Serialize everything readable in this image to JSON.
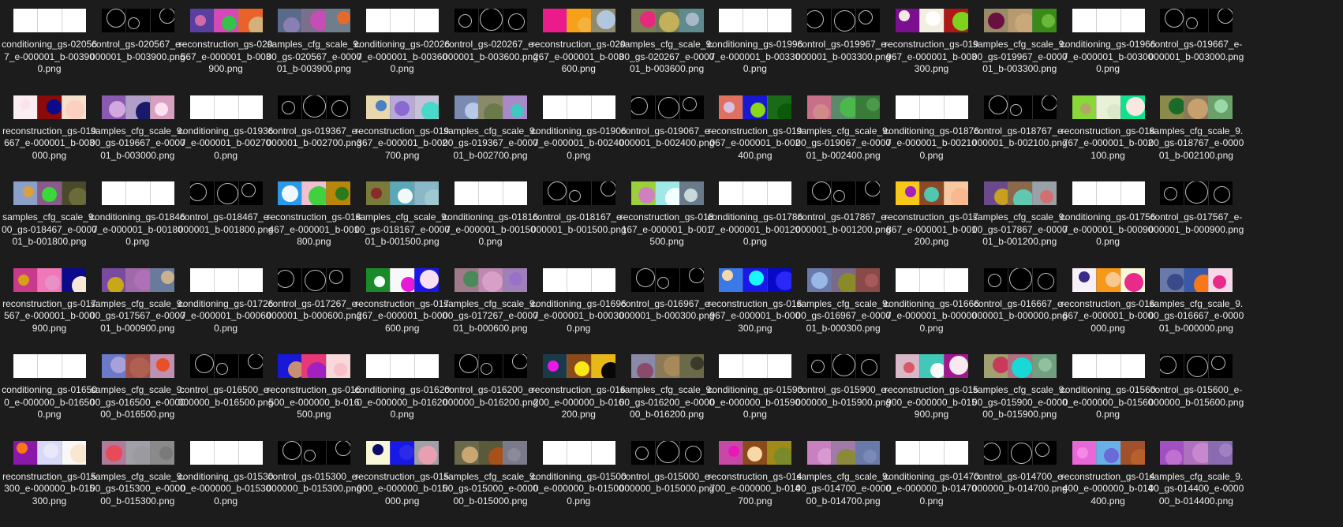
{
  "files": [
    {
      "name": "conditioning_gs-020567_e-000001_b-003900.png",
      "thumb": "cond"
    },
    {
      "name": "control_gs-020567_e-000001_b-003900.png",
      "thumb": "ctrl"
    },
    {
      "name": "reconstruction_gs-020567_e-000001_b-003900.png",
      "thumb": "color",
      "panels": [
        {
          "bg": "#5a3fa0",
          "dot": "#d36aa8"
        },
        {
          "bg": "#d946b9",
          "dot": "#33c24a"
        },
        {
          "bg": "#e8622a",
          "dot": "#d6b07a"
        }
      ]
    },
    {
      "name": "samples_cfg_scale_9.00_gs-020567_e-000001_b-003900.png",
      "thumb": "color",
      "panels": [
        {
          "bg": "#5a6a8a",
          "dot": "#8a7fb3"
        },
        {
          "bg": "#7c6f8c",
          "dot": "#c44db6"
        },
        {
          "bg": "#6f7d8c",
          "dot": "#e46b2c"
        }
      ]
    },
    {
      "name": "conditioning_gs-020267_e-000001_b-003600.png",
      "thumb": "cond"
    },
    {
      "name": "control_gs-020267_e-000001_b-003600.png",
      "thumb": "ctrl"
    },
    {
      "name": "reconstruction_gs-020267_e-000001_b-003600.png",
      "thumb": "color",
      "panels": [
        {
          "bg": "#ec1b8c",
          "dot": "#ec1b8c"
        },
        {
          "bg": "#f7a11a",
          "dot": "#f5b03d"
        },
        {
          "bg": "#8e8c6a",
          "dot": "#b2c6e0"
        }
      ]
    },
    {
      "name": "samples_cfg_scale_9.00_gs-020267_e-000001_b-003600.png",
      "thumb": "color",
      "panels": [
        {
          "bg": "#7d7d56",
          "dot": "#e5297d"
        },
        {
          "bg": "#6a7a5a",
          "dot": "#c2b15a"
        },
        {
          "bg": "#5f8a8f",
          "dot": "#a8b8c8"
        }
      ]
    },
    {
      "name": "conditioning_gs-019967_e-000001_b-003300.png",
      "thumb": "cond"
    },
    {
      "name": "control_gs-019967_e-000001_b-003300.png",
      "thumb": "ctrl"
    },
    {
      "name": "reconstruction_gs-019967_e-000001_b-003300.png",
      "thumb": "color",
      "panels": [
        {
          "bg": "#7b0f8f",
          "dot": "#f4e9e0"
        },
        {
          "bg": "#f2eee0",
          "dot": "#fefefe"
        },
        {
          "bg": "#b01818",
          "dot": "#7ed11f"
        }
      ]
    },
    {
      "name": "samples_cfg_scale_9.00_gs-019967_e-000001_b-003300.png",
      "thumb": "color",
      "panels": [
        {
          "bg": "#9a8a68",
          "dot": "#6a0f3f"
        },
        {
          "bg": "#b89a70",
          "dot": "#c9a87a"
        },
        {
          "bg": "#3a8a1a",
          "dot": "#6ab83a"
        }
      ]
    },
    {
      "name": "conditioning_gs-019667_e-000001_b-003000.png",
      "thumb": "cond"
    },
    {
      "name": "control_gs-019667_e-000001_b-003000.png",
      "thumb": "ctrl"
    },
    {
      "name": "reconstruction_gs-019667_e-000001_b-003000.png",
      "thumb": "color",
      "panels": [
        {
          "bg": "#fbeef2",
          "dot": "#fde3ea"
        },
        {
          "bg": "#8b0a0a",
          "dot": "#0a0a8a"
        },
        {
          "bg": "#f4e0cc",
          "dot": "#fbd0c0"
        }
      ]
    },
    {
      "name": "samples_cfg_scale_9.00_gs-019667_e-000001_b-003000.png",
      "thumb": "color",
      "panels": [
        {
          "bg": "#8a5ab0",
          "dot": "#d3a8e0"
        },
        {
          "bg": "#b0a0c8",
          "dot": "#1a1a6a"
        },
        {
          "bg": "#d8a0c0",
          "dot": "#fbe0ee"
        }
      ]
    },
    {
      "name": "conditioning_gs-019367_e-000001_b-002700.png",
      "thumb": "cond"
    },
    {
      "name": "control_gs-019367_e-000001_b-002700.png",
      "thumb": "ctrl"
    },
    {
      "name": "reconstruction_gs-019367_e-000001_b-002700.png",
      "thumb": "color",
      "panels": [
        {
          "bg": "#e8d8b0",
          "dot": "#4a80c0"
        },
        {
          "bg": "#b9a9d9",
          "dot": "#8a6ad0"
        },
        {
          "bg": "#c8c0d8",
          "dot": "#4ad8c8"
        }
      ]
    },
    {
      "name": "samples_cfg_scale_9.00_gs-019367_e-000001_b-002700.png",
      "thumb": "color",
      "panels": [
        {
          "bg": "#7a8ab0",
          "dot": "#b8c8e8"
        },
        {
          "bg": "#8a8a6a",
          "dot": "#6a7a4a"
        },
        {
          "bg": "#a88ac8",
          "dot": "#40c8c0"
        }
      ]
    },
    {
      "name": "conditioning_gs-019067_e-000001_b-002400.png",
      "thumb": "cond"
    },
    {
      "name": "control_gs-019067_e-000001_b-002400.png",
      "thumb": "ctrl"
    },
    {
      "name": "reconstruction_gs-019067_e-000001_b-002400.png",
      "thumb": "color",
      "panels": [
        {
          "bg": "#e07060",
          "dot": "#d8c0e0"
        },
        {
          "bg": "#1818d0",
          "dot": "#8ad818"
        },
        {
          "bg": "#1a6a1a",
          "dot": "#0a5a0a"
        }
      ]
    },
    {
      "name": "samples_cfg_scale_9.00_gs-019067_e-000001_b-002400.png",
      "thumb": "color",
      "panels": [
        {
          "bg": "#c8708a",
          "dot": "#d08a8a"
        },
        {
          "bg": "#5a8a6a",
          "dot": "#4ab84a"
        },
        {
          "bg": "#3a7a3a",
          "dot": "#4a9a4a"
        }
      ]
    },
    {
      "name": "conditioning_gs-018767_e-000001_b-002100.png",
      "thumb": "cond"
    },
    {
      "name": "control_gs-018767_e-000001_b-002100.png",
      "thumb": "ctrl"
    },
    {
      "name": "reconstruction_gs-018767_e-000001_b-002100.png",
      "thumb": "color",
      "panels": [
        {
          "bg": "#8ad838",
          "dot": "#b0a868"
        },
        {
          "bg": "#e8f0d8",
          "dot": "#d8e8c8"
        },
        {
          "bg": "#10e090",
          "dot": "#f8e8e0"
        }
      ]
    },
    {
      "name": "samples_cfg_scale_9.00_gs-018767_e-000001_b-002100.png",
      "thumb": "color",
      "panels": [
        {
          "bg": "#8a8a4a",
          "dot": "#1a6a2a"
        },
        {
          "bg": "#8a7a5a",
          "dot": "#c8a070"
        },
        {
          "bg": "#6aa06a",
          "dot": "#9ad8a8"
        }
      ]
    },
    {
      "name": "samples_cfg_scale_9.00_gs-018467_e-000001_b-001800.png",
      "thumb": "color",
      "panels": [
        {
          "bg": "#8aa0c8",
          "dot": "#d8a040"
        },
        {
          "bg": "#8a5a8a",
          "dot": "#3ad83a"
        },
        {
          "bg": "#4a4a2a",
          "dot": "#6a6a3a"
        }
      ]
    },
    {
      "name": "conditioning_gs-018467_e-000001_b-001800.png",
      "thumb": "cond"
    },
    {
      "name": "control_gs-018467_e-000001_b-001800.png",
      "thumb": "ctrl"
    },
    {
      "name": "reconstruction_gs-018467_e-000001_b-001800.png",
      "thumb": "color",
      "panels": [
        {
          "bg": "#2a9ae8",
          "dot": "#f0f8ff"
        },
        {
          "bg": "#f0c0d0",
          "dot": "#40d040"
        },
        {
          "bg": "#b8860b",
          "dot": "#2a7a1a"
        }
      ]
    },
    {
      "name": "samples_cfg_scale_9.00_gs-018167_e-000001_b-001500.png",
      "thumb": "color",
      "panels": [
        {
          "bg": "#7a7a3a",
          "dot": "#8a2a2a"
        },
        {
          "bg": "#5aa8b8",
          "dot": "#f0f8f8"
        },
        {
          "bg": "#8ab8c8",
          "dot": "#a0c8d0"
        }
      ]
    },
    {
      "name": "conditioning_gs-018167_e-000001_b-001500.png",
      "thumb": "cond"
    },
    {
      "name": "control_gs-018167_e-000001_b-001500.png",
      "thumb": "ctrl"
    },
    {
      "name": "reconstruction_gs-018167_e-000001_b-001500.png",
      "thumb": "color",
      "panels": [
        {
          "bg": "#9ad038",
          "dot": "#d080c0"
        },
        {
          "bg": "#a0e8e8",
          "dot": "#f0ffff"
        },
        {
          "bg": "#6a7a8a",
          "dot": "#c8d8d8"
        }
      ]
    },
    {
      "name": "conditioning_gs-017867_e-000001_b-001200.png",
      "thumb": "cond"
    },
    {
      "name": "control_gs-017867_e-000001_b-001200.png",
      "thumb": "ctrl"
    },
    {
      "name": "reconstruction_gs-017867_e-000001_b-001200.png",
      "thumb": "color",
      "panels": [
        {
          "bg": "#f8c818",
          "dot": "#a020c0"
        },
        {
          "bg": "#8a4a2a",
          "dot": "#50c8b0"
        },
        {
          "bg": "#f8c8a0",
          "dot": "#f8b890"
        }
      ]
    },
    {
      "name": "samples_cfg_scale_9.00_gs-017867_e-000001_b-001200.png",
      "thumb": "color",
      "panels": [
        {
          "bg": "#6a4a8a",
          "dot": "#c8a020"
        },
        {
          "bg": "#8a6a4a",
          "dot": "#60c8b0"
        },
        {
          "bg": "#9aa0a8",
          "dot": "#d07070"
        }
      ]
    },
    {
      "name": "conditioning_gs-017567_e-000001_b-000900.png",
      "thumb": "cond"
    },
    {
      "name": "control_gs-017567_e-000001_b-000900.png",
      "thumb": "ctrl"
    },
    {
      "name": "reconstruction_gs-017567_e-000001_b-000900.png",
      "thumb": "color",
      "panels": [
        {
          "bg": "#c83a8a",
          "dot": "#d8a018"
        },
        {
          "bg": "#f078b8",
          "dot": "#e890c8"
        },
        {
          "bg": "#0a0a8a",
          "dot": "#f8e8d8"
        }
      ]
    },
    {
      "name": "samples_cfg_scale_9.00_gs-017567_e-000001_b-000900.png",
      "thumb": "color",
      "panels": [
        {
          "bg": "#7a4aa0",
          "dot": "#c8a818"
        },
        {
          "bg": "#a06aa8",
          "dot": "#b070b8"
        },
        {
          "bg": "#6a7a9a",
          "dot": "#c8b090"
        }
      ]
    },
    {
      "name": "conditioning_gs-017267_e-000001_b-000600.png",
      "thumb": "cond"
    },
    {
      "name": "control_gs-017267_e-000001_b-000600.png",
      "thumb": "ctrl"
    },
    {
      "name": "reconstruction_gs-017267_e-000001_b-000600.png",
      "thumb": "color",
      "panels": [
        {
          "bg": "#1a8a2a",
          "dot": "#f0fff8"
        },
        {
          "bg": "#f8f8f8",
          "dot": "#e818d8"
        },
        {
          "bg": "#1818e8",
          "dot": "#f8e0f0"
        }
      ]
    },
    {
      "name": "samples_cfg_scale_9.00_gs-017267_e-000001_b-000600.png",
      "thumb": "color",
      "panels": [
        {
          "bg": "#a07a8a",
          "dot": "#4a8a5a"
        },
        {
          "bg": "#c088b0",
          "dot": "#d8a0c8"
        },
        {
          "bg": "#a080b8",
          "dot": "#9a70c8"
        }
      ]
    },
    {
      "name": "conditioning_gs-016967_e-000001_b-000300.png",
      "thumb": "cond"
    },
    {
      "name": "control_gs-016967_e-000001_b-000300.png",
      "thumb": "ctrl"
    },
    {
      "name": "reconstruction_gs-016967_e-000001_b-000300.png",
      "thumb": "color",
      "panels": [
        {
          "bg": "#3a7ae8",
          "dot": "#f8d8a8"
        },
        {
          "bg": "#1818e8",
          "dot": "#18f8f8"
        },
        {
          "bg": "#0808c8",
          "dot": "#2828f8"
        }
      ]
    },
    {
      "name": "samples_cfg_scale_9.00_gs-016967_e-000001_b-000300.png",
      "thumb": "color",
      "panels": [
        {
          "bg": "#6a7aa8",
          "dot": "#98b8e8"
        },
        {
          "bg": "#7a6a8a",
          "dot": "#8a8a2a"
        },
        {
          "bg": "#8a4a4a",
          "dot": "#a85a5a"
        }
      ]
    },
    {
      "name": "conditioning_gs-016667_e-000001_b-000000.png",
      "thumb": "cond"
    },
    {
      "name": "control_gs-016667_e-000001_b-000000.png",
      "thumb": "ctrl"
    },
    {
      "name": "reconstruction_gs-016667_e-000001_b-000000.png",
      "thumb": "color",
      "panels": [
        {
          "bg": "#f8f0f8",
          "dot": "#3a2a8a"
        },
        {
          "bg": "#f89818",
          "dot": "#f8c890"
        },
        {
          "bg": "#f8f8d8",
          "dot": "#e82a8a"
        }
      ]
    },
    {
      "name": "samples_cfg_scale_9.00_gs-016667_e-000001_b-000000.png",
      "thumb": "color",
      "panels": [
        {
          "bg": "#6a7aa8",
          "dot": "#3a4a8a"
        },
        {
          "bg": "#3a5aa8",
          "dot": "#f87818"
        },
        {
          "bg": "#f8d8e8",
          "dot": "#e82a8a"
        }
      ]
    },
    {
      "name": "conditioning_gs-016500_e-000000_b-016500.png",
      "thumb": "cond"
    },
    {
      "name": "samples_cfg_scale_9.00_gs-016500_e-000000_b-016500.png",
      "thumb": "color",
      "panels": [
        {
          "bg": "#6a7ac8",
          "dot": "#a8a0d8"
        },
        {
          "bg": "#a0504a",
          "dot": "#b06050"
        },
        {
          "bg": "#c090b0",
          "dot": "#e8502a"
        }
      ]
    },
    {
      "name": "control_gs-016500_e-000000_b-016500.png",
      "thumb": "ctrl"
    },
    {
      "name": "reconstruction_gs-016500_e-000000_b-016500.png",
      "thumb": "color",
      "panels": [
        {
          "bg": "#1818d8",
          "dot": "#c89070"
        },
        {
          "bg": "#e83878",
          "dot": "#a020c0"
        },
        {
          "bg": "#f8d8d8",
          "dot": "#f8c0c8"
        }
      ]
    },
    {
      "name": "conditioning_gs-016200_e-000000_b-016200.png",
      "thumb": "cond"
    },
    {
      "name": "control_gs-016200_e-000000_b-016200.png",
      "thumb": "ctrl"
    },
    {
      "name": "reconstruction_gs-016200_e-000000_b-016200.png",
      "thumb": "color",
      "panels": [
        {
          "bg": "#1a3a4a",
          "dot": "#e818e8"
        },
        {
          "bg": "#8a4a1a",
          "dot": "#f8e818"
        },
        {
          "bg": "#e8b818",
          "dot": "#080808"
        }
      ]
    },
    {
      "name": "samples_cfg_scale_9.00_gs-016200_e-000000_b-016200.png",
      "thumb": "color",
      "panels": [
        {
          "bg": "#8a8aa8",
          "dot": "#8a4a6a"
        },
        {
          "bg": "#8a7a5a",
          "dot": "#a88a5a"
        },
        {
          "bg": "#6a6a4a",
          "dot": "#3a3a2a"
        }
      ]
    },
    {
      "name": "conditioning_gs-015900_e-000000_b-015900.png",
      "thumb": "cond"
    },
    {
      "name": "control_gs-015900_e-000000_b-015900.png",
      "thumb": "ctrl"
    },
    {
      "name": "reconstruction_gs-015900_e-000000_b-015900.png",
      "thumb": "color",
      "panels": [
        {
          "bg": "#d8b8c8",
          "dot": "#d85a6a"
        },
        {
          "bg": "#40c8b8",
          "dot": "#f8f8f8"
        },
        {
          "bg": "#a01890",
          "dot": "#f8e8f0"
        }
      ]
    },
    {
      "name": "samples_cfg_scale_9.00_gs-015900_e-000000_b-015900.png",
      "thumb": "color",
      "panels": [
        {
          "bg": "#a0a070",
          "dot": "#c83a5a"
        },
        {
          "bg": "#b07080",
          "dot": "#18d8d8"
        },
        {
          "bg": "#70a080",
          "dot": "#90c0a0"
        }
      ]
    },
    {
      "name": "conditioning_gs-015600_e-000000_b-015600.png",
      "thumb": "cond"
    },
    {
      "name": "control_gs-015600_e-000000_b-015600.png",
      "thumb": "ctrl"
    },
    {
      "name": "reconstruction_gs-015300_e-000000_b-015300.png",
      "thumb": "color",
      "panels": [
        {
          "bg": "#8a18a8",
          "dot": "#f87818"
        },
        {
          "bg": "#d8d8f8",
          "dot": "#e8e8f8"
        },
        {
          "bg": "#f8f8f8",
          "dot": "#f8e8d0"
        }
      ]
    },
    {
      "name": "samples_cfg_scale_9.00_gs-015300_e-000000_b-015300.png",
      "thumb": "color",
      "panels": [
        {
          "bg": "#b07a9a",
          "dot": "#e84a5a"
        },
        {
          "bg": "#a0a0a8",
          "dot": "#9a9aa0"
        },
        {
          "bg": "#8a8a8a",
          "dot": "#7a7a7a"
        }
      ]
    },
    {
      "name": "conditioning_gs-015300_e-000000_b-015300.png",
      "thumb": "cond"
    },
    {
      "name": "control_gs-015300_e-000000_b-015300.png",
      "thumb": "ctrl"
    },
    {
      "name": "reconstruction_gs-015000_e-000000_b-015000.png",
      "thumb": "color",
      "panels": [
        {
          "bg": "#f8f8d8",
          "dot": "#0a0a6a"
        },
        {
          "bg": "#1818e8",
          "dot": "#2a2ae8"
        },
        {
          "bg": "#a0a0a8",
          "dot": "#e8a0b0"
        }
      ]
    },
    {
      "name": "samples_cfg_scale_9.00_gs-015000_e-000000_b-015000.png",
      "thumb": "color",
      "panels": [
        {
          "bg": "#6a6a4a",
          "dot": "#c8a870"
        },
        {
          "bg": "#5a5a3a",
          "dot": "#a8501a"
        },
        {
          "bg": "#7a7a8a",
          "dot": "#8a8a9a"
        }
      ]
    },
    {
      "name": "conditioning_gs-015000_e-000000_b-015000.png",
      "thumb": "cond"
    },
    {
      "name": "control_gs-015000_e-000000_b-015000.png",
      "thumb": "ctrl"
    },
    {
      "name": "reconstruction_gs-014700_e-000000_b-014700.png",
      "thumb": "color",
      "panels": [
        {
          "bg": "#c848a8",
          "dot": "#e818b8"
        },
        {
          "bg": "#8a4a1a",
          "dot": "#f8d8a8"
        },
        {
          "bg": "#a08a18",
          "dot": "#7a8a2a"
        }
      ]
    },
    {
      "name": "samples_cfg_scale_9.00_gs-014700_e-000000_b-014700.png",
      "thumb": "color",
      "panels": [
        {
          "bg": "#c880c0",
          "dot": "#d898d0"
        },
        {
          "bg": "#a07aa8",
          "dot": "#8a8a3a"
        },
        {
          "bg": "#6a7aa8",
          "dot": "#7a8ab8"
        }
      ]
    },
    {
      "name": "conditioning_gs-014700_e-000000_b-014700.png",
      "thumb": "cond"
    },
    {
      "name": "control_gs-014700_e-000000_b-014700.png",
      "thumb": "ctrl"
    },
    {
      "name": "reconstruction_gs-014400_e-000000_b-014400.png",
      "thumb": "color",
      "panels": [
        {
          "bg": "#e868d8",
          "dot": "#f888e8"
        },
        {
          "bg": "#6ab0e8",
          "dot": "#6a6ad8"
        },
        {
          "bg": "#a0502a",
          "dot": "#b8602a"
        }
      ]
    },
    {
      "name": "samples_cfg_scale_9.00_gs-014400_e-000000_b-014400.png",
      "thumb": "color",
      "panels": [
        {
          "bg": "#a050c0",
          "dot": "#c070d0"
        },
        {
          "bg": "#b070c0",
          "dot": "#c888d0"
        },
        {
          "bg": "#8a6ab0",
          "dot": "#a080c0"
        }
      ]
    }
  ]
}
